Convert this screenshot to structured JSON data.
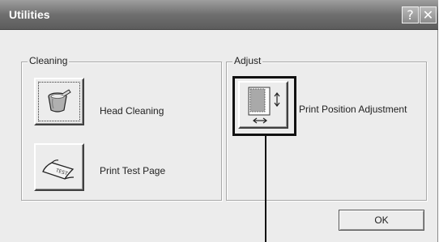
{
  "window": {
    "title": "Utilities"
  },
  "titlebar_buttons": {
    "help": "?",
    "close": "✕"
  },
  "cleaning": {
    "group_label": "Cleaning",
    "head_cleaning_label": "Head Cleaning",
    "print_test_page_label": "Print Test Page",
    "test_paper_text": "TEST"
  },
  "adjust": {
    "group_label": "Adjust",
    "print_position_label": "Print Position Adjustment"
  },
  "dialog": {
    "ok_label": "OK"
  },
  "icons": {
    "head_cleaning": "ink-cup-icon",
    "print_test_page": "test-page-icon",
    "print_position": "print-position-icon"
  }
}
